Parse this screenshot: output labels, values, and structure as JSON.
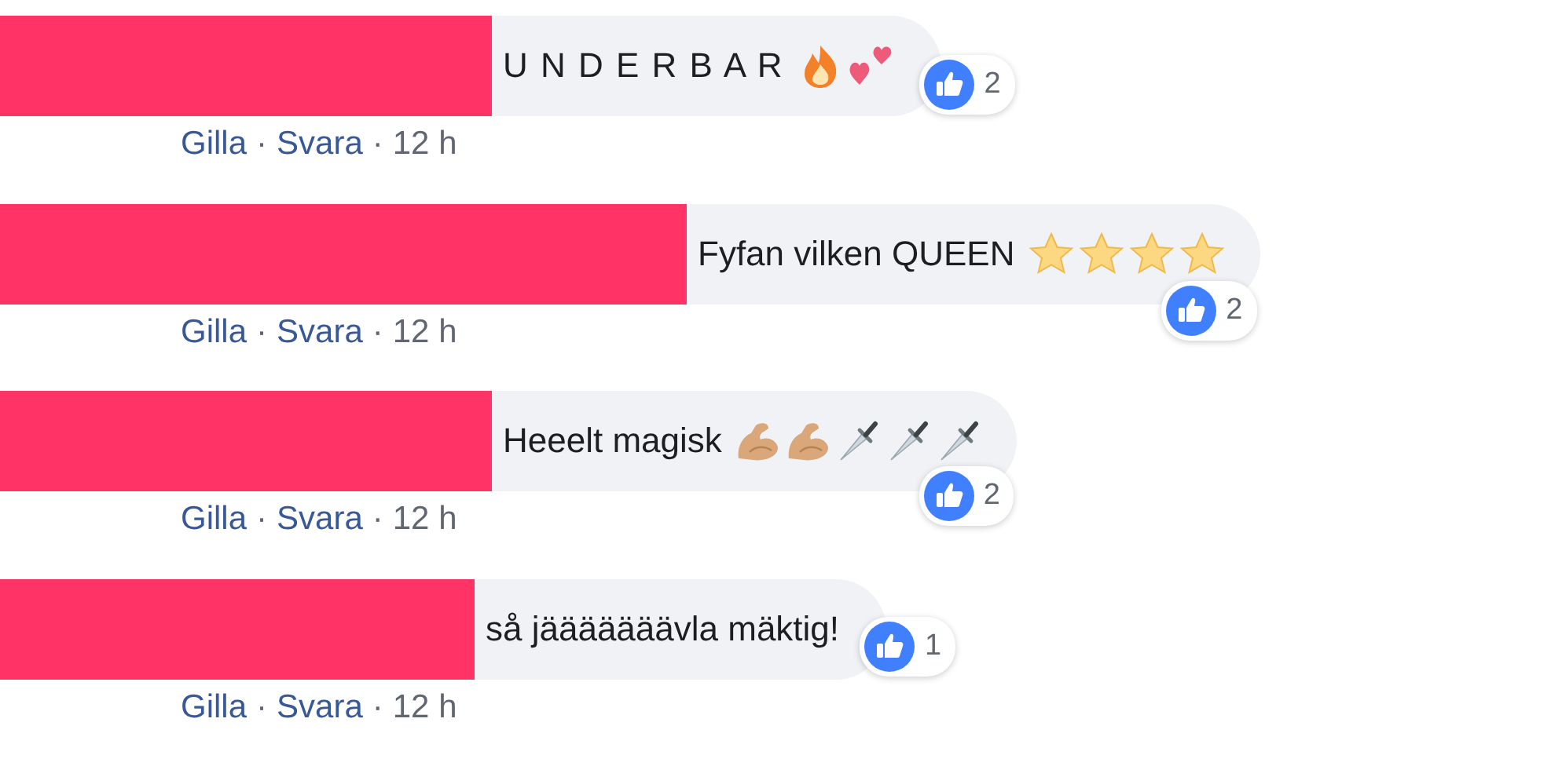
{
  "comments": [
    {
      "text": "U N D E R B A R",
      "emoji": [
        {
          "kind": "fire"
        },
        {
          "kind": "hearts"
        }
      ],
      "likes": "2",
      "actions": [
        {
          "kind": "link",
          "text": "Gilla"
        },
        {
          "kind": "dot",
          "text": "·"
        },
        {
          "kind": "link",
          "text": "Svara"
        },
        {
          "kind": "dot",
          "text": "·"
        },
        {
          "kind": "time",
          "text": "12 h"
        }
      ]
    },
    {
      "text": "Fyfan vilken QUEEN",
      "emoji": [
        {
          "kind": "star"
        },
        {
          "kind": "star"
        },
        {
          "kind": "star"
        },
        {
          "kind": "star"
        }
      ],
      "likes": "2",
      "actions": [
        {
          "kind": "link",
          "text": "Gilla"
        },
        {
          "kind": "dot",
          "text": "·"
        },
        {
          "kind": "link",
          "text": "Svara"
        },
        {
          "kind": "dot",
          "text": "·"
        },
        {
          "kind": "time",
          "text": "12 h"
        }
      ]
    },
    {
      "text": "Heeelt magisk",
      "emoji": [
        {
          "kind": "muscle"
        },
        {
          "kind": "muscle"
        },
        {
          "kind": "dagger"
        },
        {
          "kind": "dagger"
        },
        {
          "kind": "dagger"
        }
      ],
      "likes": "2",
      "actions": [
        {
          "kind": "link",
          "text": "Gilla"
        },
        {
          "kind": "dot",
          "text": "·"
        },
        {
          "kind": "link",
          "text": "Svara"
        },
        {
          "kind": "dot",
          "text": "·"
        },
        {
          "kind": "time",
          "text": "12 h"
        }
      ]
    },
    {
      "text": "så jääääääävla mäktig!",
      "likes": "1",
      "actions": [
        {
          "kind": "link",
          "text": "Gilla"
        },
        {
          "kind": "dot",
          "text": "·"
        },
        {
          "kind": "link",
          "text": "Svara"
        },
        {
          "kind": "dot",
          "text": "·"
        },
        {
          "kind": "time",
          "text": "12 h"
        }
      ]
    }
  ]
}
